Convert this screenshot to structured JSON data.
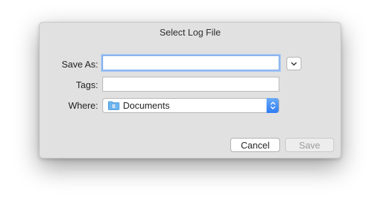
{
  "dialog": {
    "title": "Select Log File"
  },
  "form": {
    "save_as_label": "Save As:",
    "save_as_value": "",
    "tags_label": "Tags:",
    "tags_value": "",
    "where_label": "Where:",
    "where_value": "Documents"
  },
  "buttons": {
    "cancel_label": "Cancel",
    "save_label": "Save",
    "save_enabled": false
  },
  "icons": {
    "expand": "chevron-down-icon",
    "folder": "documents-folder-icon",
    "stepper": "up-down-arrows-icon"
  },
  "colors": {
    "accent": "#2f7df4",
    "focus_ring": "#9ec3f5"
  }
}
